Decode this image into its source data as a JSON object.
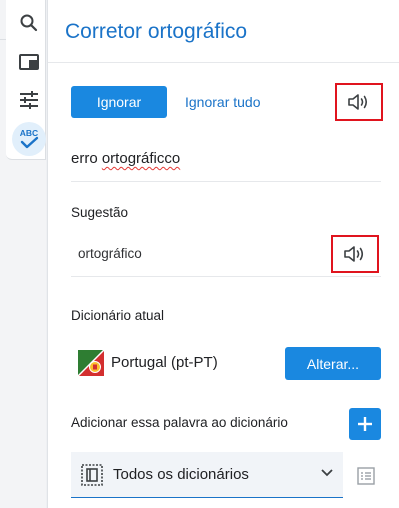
{
  "rail": {
    "items": [
      {
        "icon": "search-icon"
      },
      {
        "icon": "panel-icon"
      },
      {
        "icon": "sliders-icon"
      },
      {
        "icon": "spellcheck-icon",
        "text": "ABC"
      }
    ]
  },
  "panel": {
    "title": "Corretor ortográfico",
    "ignore_label": "Ignorar",
    "ignore_all_label": "Ignorar tudo",
    "word_prefix": "erro ",
    "word_misspelled": "ortográficco",
    "suggestion_label": "Sugestão",
    "suggestion": "ortográfico",
    "dictionary_label": "Dicionário atual",
    "dictionary_name": "Portugal (pt-PT)",
    "change_label": "Alterar...",
    "add_word_label": "Adicionar essa palavra ao dicionário",
    "dictionary_select_value": "Todos os dicionários"
  },
  "colors": {
    "accent": "#1a88e0",
    "title": "#1a73c8",
    "highlight_box": "#e0141e",
    "misspelling_underline": "#e53935"
  }
}
